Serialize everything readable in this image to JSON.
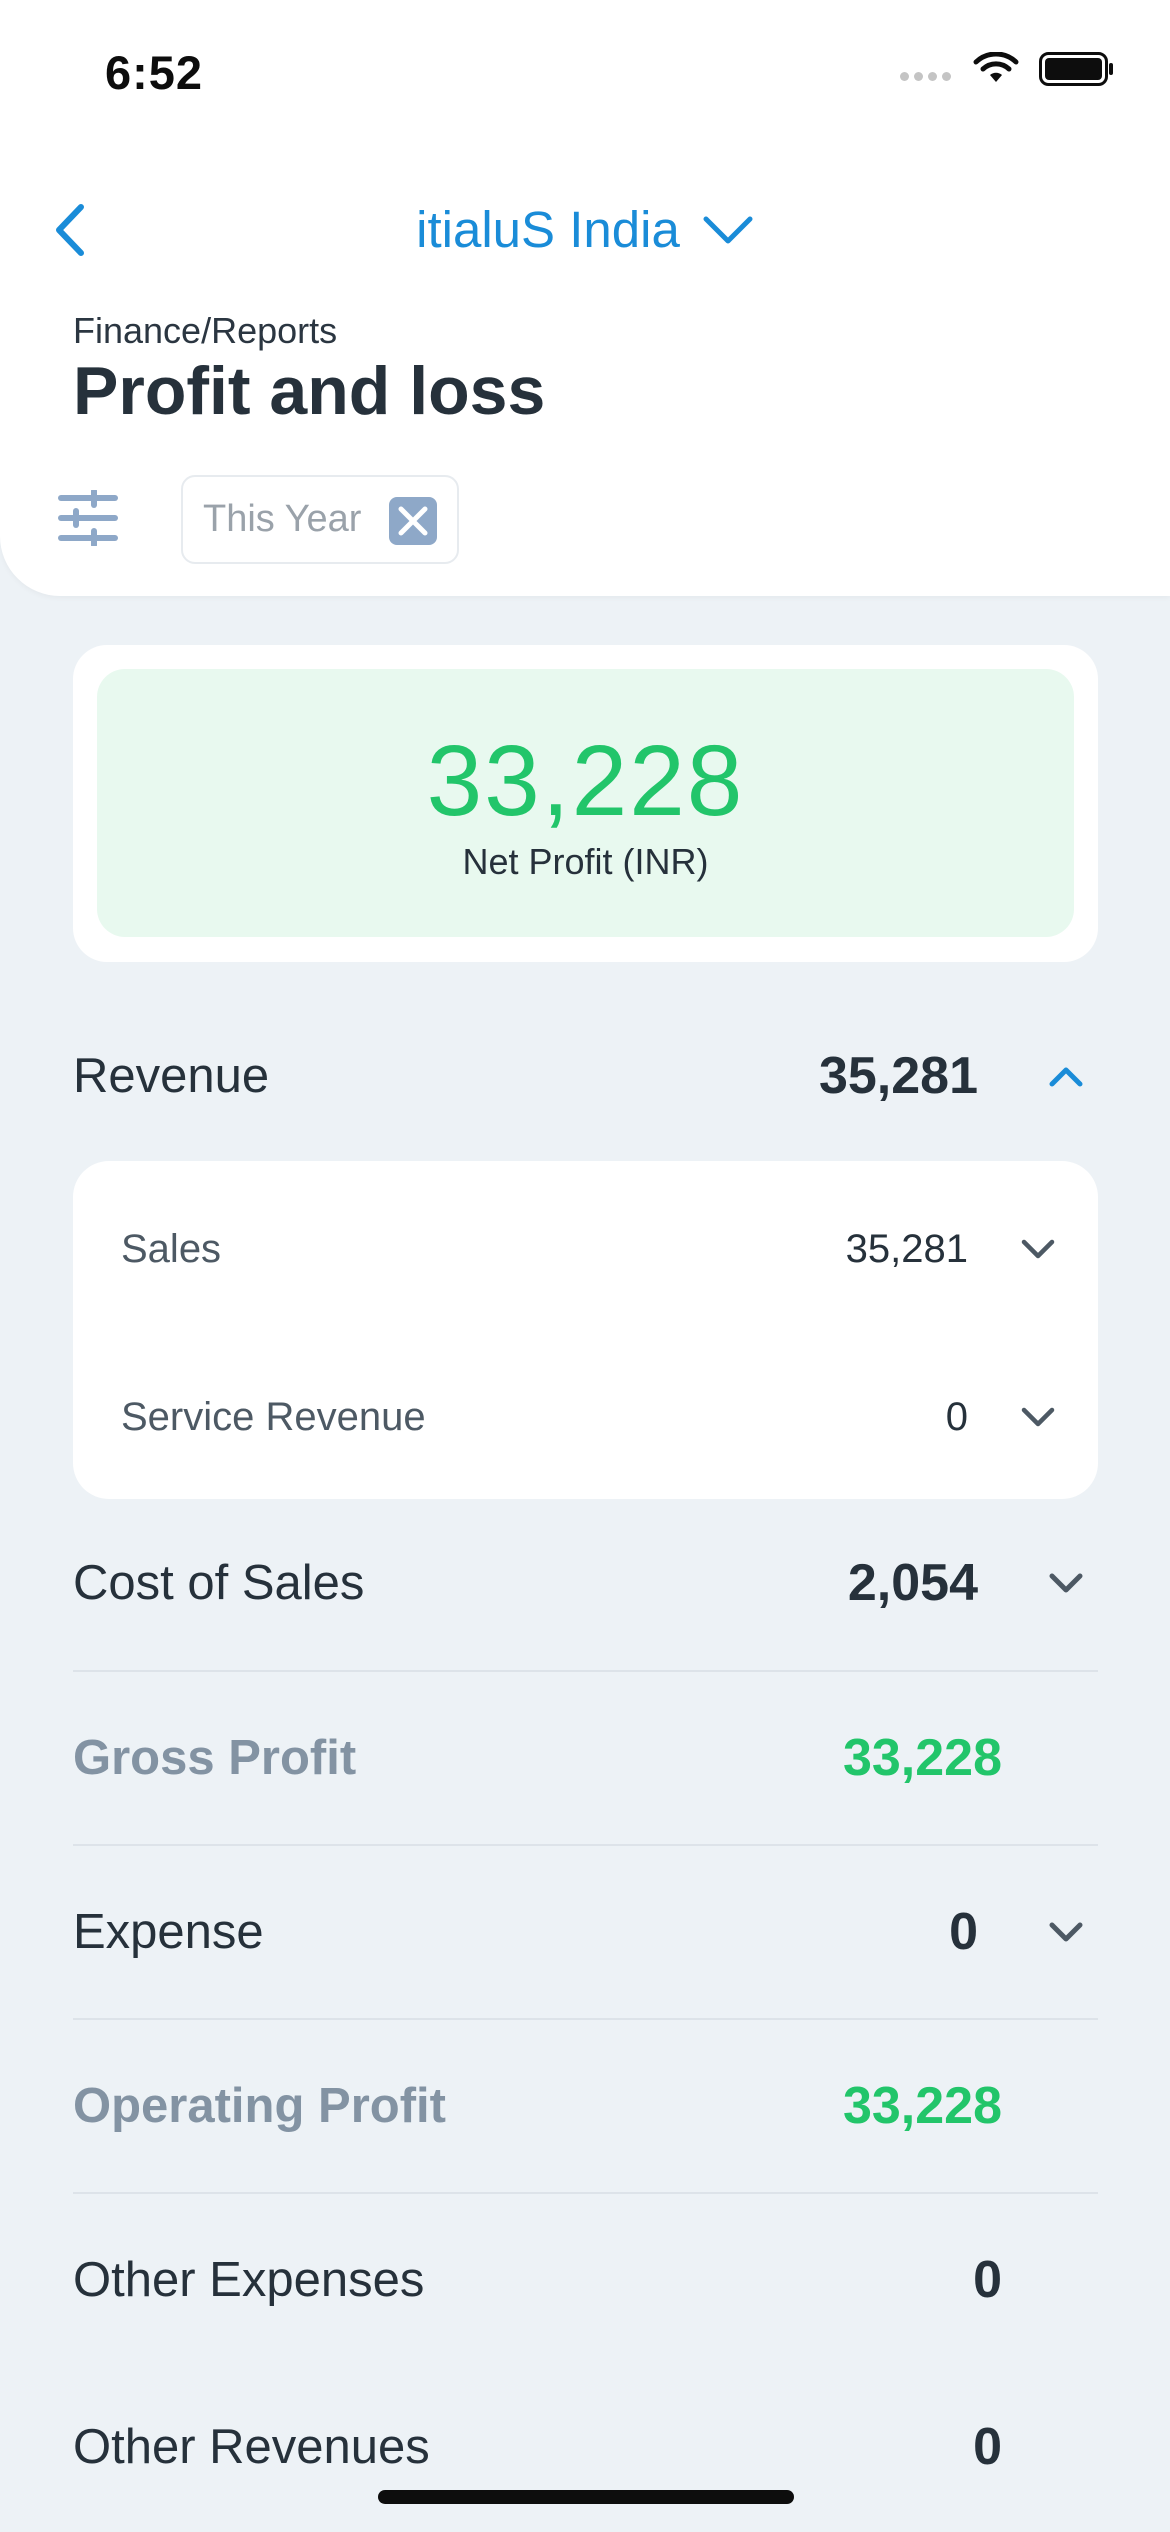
{
  "status_bar": {
    "time": "6:52"
  },
  "header": {
    "org_name": "itialuS India",
    "breadcrumb": "Finance/Reports",
    "title": "Profit and loss",
    "filter_chip": "This Year"
  },
  "kpi": {
    "value": "33,228",
    "label": "Net Profit (INR)",
    "value_color": "#22c56a"
  },
  "revenue": {
    "label": "Revenue",
    "value": "35,281",
    "expanded": true,
    "items": [
      {
        "label": "Sales",
        "value": "35,281"
      },
      {
        "label": "Service Revenue",
        "value": "0"
      }
    ]
  },
  "rows": [
    {
      "label": "Cost of Sales",
      "value": "2,054",
      "expandable": true
    },
    {
      "label": "Gross Profit",
      "value": "33,228",
      "subtotal": true
    },
    {
      "label": "Expense",
      "value": "0",
      "expandable": true
    },
    {
      "label": "Operating Profit",
      "value": "33,228",
      "subtotal": true
    },
    {
      "label": "Other Expenses",
      "value": "0"
    },
    {
      "label": "Other Revenues",
      "value": "0"
    }
  ],
  "colors": {
    "accent": "#1a8cd8",
    "positive": "#22c56a",
    "background": "#edf2f6"
  }
}
